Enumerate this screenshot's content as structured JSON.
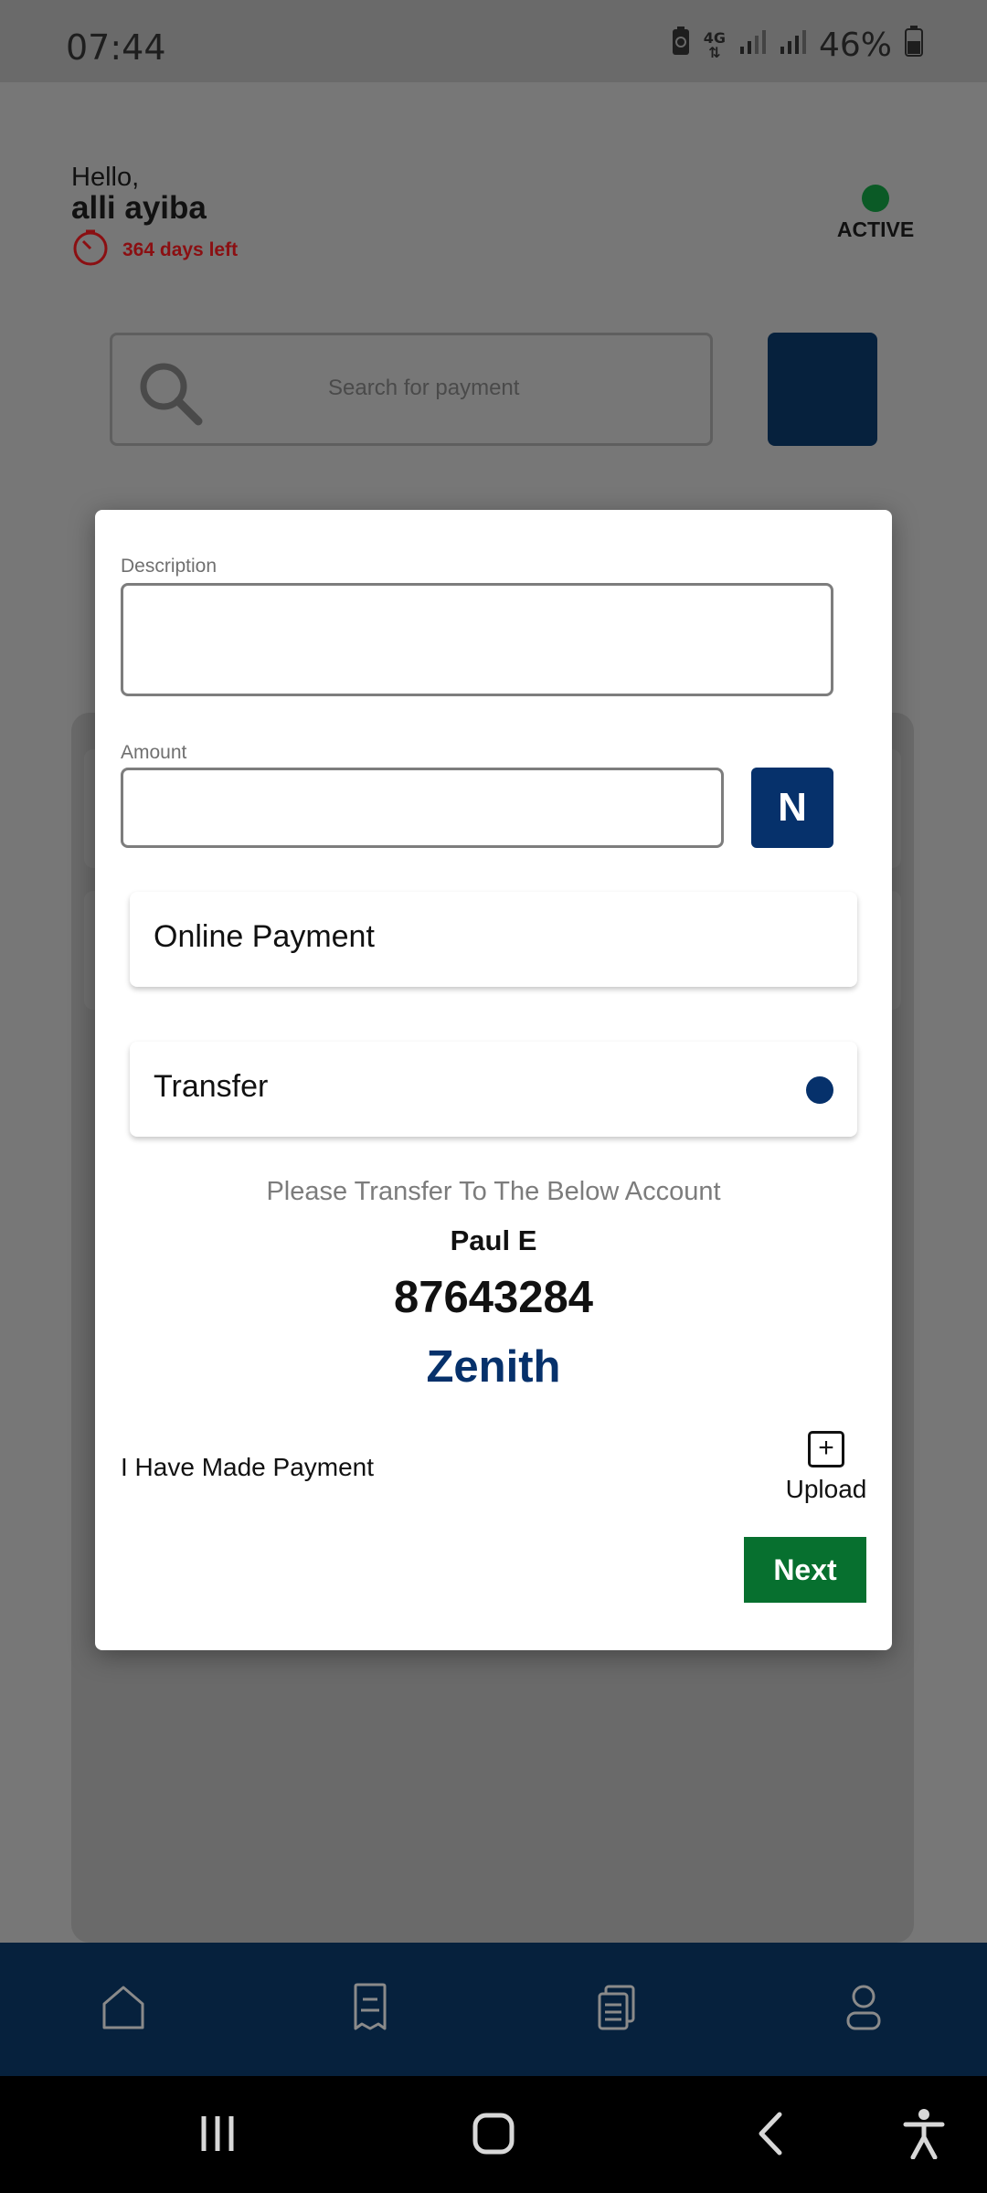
{
  "status_bar": {
    "time": "07:44",
    "network": "4G",
    "battery": "46%"
  },
  "header": {
    "greeting": "Hello,",
    "user_name": "alli ayiba",
    "days_left": "364 days left",
    "status": "ACTIVE",
    "status_color": "#0b5a26"
  },
  "search": {
    "placeholder": "Search for payment"
  },
  "modal": {
    "description_label": "Description",
    "description_value": "",
    "amount_label": "Amount",
    "amount_value": "",
    "currency_label": "N",
    "payment_options": [
      {
        "label": "Online Payment",
        "selected": false
      },
      {
        "label": "Transfer",
        "selected": true
      }
    ],
    "transfer_note": "Please Transfer To The Below Account",
    "account_name": "Paul E",
    "account_number": "87643284",
    "bank_name": "Zenith",
    "confirm_label": "I Have Made Payment",
    "upload_label": "Upload",
    "next_label": "Next"
  },
  "bottom_nav": {
    "items": [
      "home-icon",
      "receipt-icon",
      "documents-icon",
      "profile-icon"
    ]
  },
  "colors": {
    "primary": "#06316b",
    "navy": "#06213d",
    "next_green": "#07702f",
    "days_red": "#8b0f12"
  }
}
